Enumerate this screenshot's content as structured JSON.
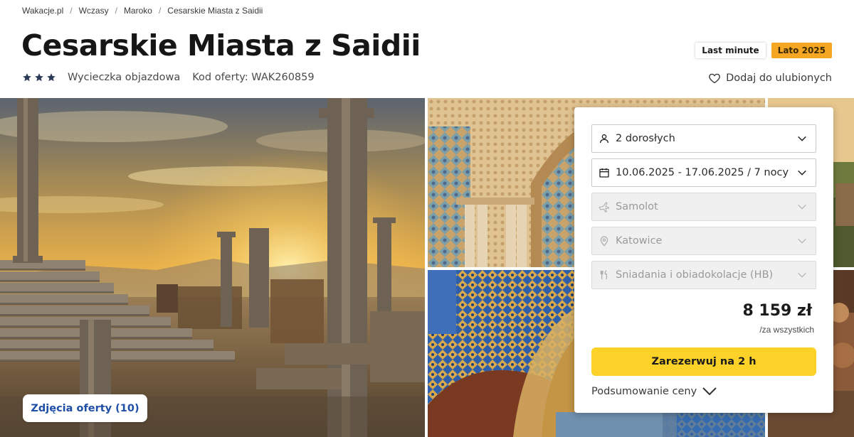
{
  "breadcrumb": [
    "Wakacje.pl",
    "Wczasy",
    "Maroko",
    "Cesarskie Miasta z Saidii"
  ],
  "breadcrumb_separator": "/",
  "title": "Cesarskie Miasta z Saidii",
  "rating_stars": 3,
  "trip_type": "Wycieczka objazdowa",
  "offer_code": "Kod oferty: WAK260859",
  "badges": {
    "last_minute": "Last minute",
    "season": "Lato 2025"
  },
  "favorite_label": "Dodaj do ulubionych",
  "photos_button": "Zdjęcia oferty (10)",
  "booking": {
    "travelers": "2 dorosłych",
    "dates": "10.06.2025 - 17.06.2025 / 7 nocy",
    "transport": "Samolot",
    "departure": "Katowice",
    "board": "Śniadania i obiadokolacje (HB)",
    "price": "8 159 zł",
    "price_note": "/za wszystkich",
    "book_label": "Zarezerwuj na 2 h",
    "summary_label": "Podsumowanie ceny"
  },
  "icons": {
    "stars": "star-icon",
    "favorite": "heart-icon",
    "travelers": "person-icon",
    "dates": "calendar-icon",
    "transport": "plane-icon",
    "departure": "location-pin-icon",
    "board": "cutlery-icon",
    "dropdown": "chevron-down-icon"
  },
  "colors": {
    "accent_yellow": "#fcd229",
    "season_badge": "#f5a623",
    "link_blue": "#1f4fa6",
    "title": "#161616"
  }
}
